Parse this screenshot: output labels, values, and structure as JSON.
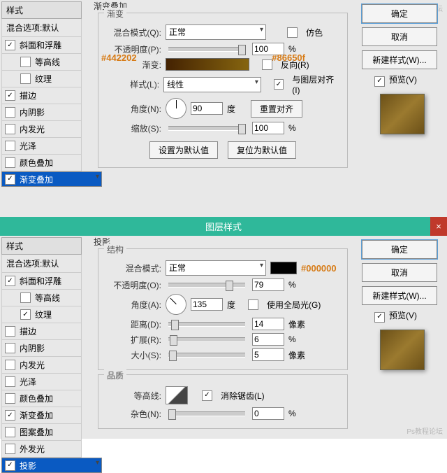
{
  "watermark": "Ps教程论坛",
  "top": {
    "group_title": "渐变叠加",
    "fieldset": "渐变",
    "side": {
      "header": "样式",
      "sub": "混合选项:默认",
      "items": [
        {
          "label": "斜面和浮雕",
          "checked": true,
          "indent": false
        },
        {
          "label": "等高线",
          "checked": false,
          "indent": true
        },
        {
          "label": "纹理",
          "checked": false,
          "indent": true
        },
        {
          "label": "描边",
          "checked": true,
          "indent": false
        },
        {
          "label": "内阴影",
          "checked": false,
          "indent": false
        },
        {
          "label": "内发光",
          "checked": false,
          "indent": false
        },
        {
          "label": "光泽",
          "checked": false,
          "indent": false
        },
        {
          "label": "颜色叠加",
          "checked": false,
          "indent": false
        },
        {
          "label": "渐变叠加",
          "checked": true,
          "indent": false,
          "sel": true
        }
      ]
    },
    "labels": {
      "blend": "混合模式(Q):",
      "opacity": "不透明度(P):",
      "gradient": "渐变:",
      "style": "样式(L):",
      "angle": "角度(N):",
      "scale": "缩放(S):",
      "deg": "度",
      "pct": "%"
    },
    "blend_val": "正常",
    "style_val": "线性",
    "opacity": "100",
    "angle": "90",
    "scale": "100",
    "cb": {
      "dither": "仿色",
      "reverse": "反向(R)",
      "align": "与图层对齐(I)"
    },
    "anno": {
      "left": "#442202",
      "right": "#86650f"
    },
    "btns": {
      "reset_angle": "重置对齐",
      "set_default": "设置为默认值",
      "reset_default": "复位为默认值"
    },
    "right": {
      "ok": "确定",
      "cancel": "取消",
      "new": "新建样式(W)...",
      "preview": "预览(V)"
    }
  },
  "mid": {
    "title": "图层样式",
    "close": "×"
  },
  "bot": {
    "group_title": "投影",
    "fs_struct": "结构",
    "fs_quality": "品质",
    "side": {
      "header": "样式",
      "sub": "混合选项:默认",
      "items": [
        {
          "label": "斜面和浮雕",
          "checked": true,
          "indent": false
        },
        {
          "label": "等高线",
          "checked": false,
          "indent": true
        },
        {
          "label": "纹理",
          "checked": true,
          "indent": true
        },
        {
          "label": "描边",
          "checked": false,
          "indent": false
        },
        {
          "label": "内阴影",
          "checked": false,
          "indent": false
        },
        {
          "label": "内发光",
          "checked": false,
          "indent": false
        },
        {
          "label": "光泽",
          "checked": false,
          "indent": false
        },
        {
          "label": "颜色叠加",
          "checked": false,
          "indent": false
        },
        {
          "label": "渐变叠加",
          "checked": true,
          "indent": false
        },
        {
          "label": "图案叠加",
          "checked": false,
          "indent": false
        },
        {
          "label": "外发光",
          "checked": false,
          "indent": false
        },
        {
          "label": "投影",
          "checked": true,
          "indent": false,
          "sel": true
        }
      ]
    },
    "labels": {
      "blend": "混合模式:",
      "opacity": "不透明度(O):",
      "angle": "角度(A):",
      "distance": "距离(D):",
      "spread": "扩展(R):",
      "size": "大小(S):",
      "contour": "等高线:",
      "noise": "杂色(N):",
      "deg": "度",
      "px": "像素",
      "pct": "%"
    },
    "blend_val": "正常",
    "opacity": "79",
    "angle": "135",
    "distance": "14",
    "spread": "6",
    "size": "5",
    "noise": "0",
    "cb": {
      "global": "使用全局光(G)",
      "antialias": "消除锯齿(L)"
    },
    "anno": "#000000",
    "right": {
      "ok": "确定",
      "cancel": "取消",
      "new": "新建样式(W)...",
      "preview": "预览(V)"
    }
  }
}
